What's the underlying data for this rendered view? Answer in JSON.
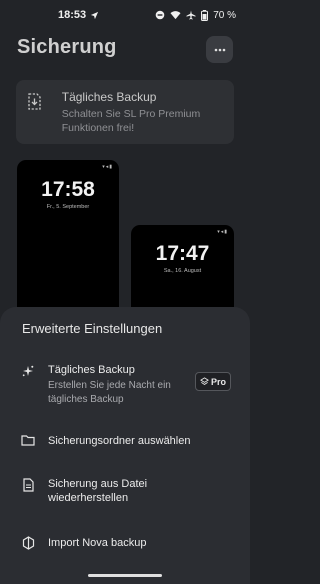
{
  "status_bar": {
    "time": "18:53",
    "battery": "70 %"
  },
  "page": {
    "title": "Sicherung"
  },
  "banner": {
    "title": "Tägliches Backup",
    "subtitle": "Schalten Sie SL Pro Premium Funktionen frei!"
  },
  "previews": [
    {
      "clock": "17:58",
      "date": "Fr., 5. September"
    },
    {
      "clock": "17:47",
      "date": "Sa., 16. August"
    }
  ],
  "sheet": {
    "title": "Erweiterte Einstellungen",
    "items": [
      {
        "label": "Tägliches Backup",
        "sublabel": "Erstellen Sie jede Nacht ein tägliches Backup",
        "badge": "Pro",
        "icon": "sparkle-icon"
      },
      {
        "label": "Sicherungsordner auswählen",
        "icon": "folder-icon"
      },
      {
        "label": "Sicherung aus Datei wiederherstellen",
        "icon": "file-icon"
      },
      {
        "label": "Import Nova backup",
        "icon": "nova-icon"
      }
    ]
  },
  "colors": {
    "background": "#222428",
    "sheet": "#2b2d32",
    "card": "#2e3034"
  }
}
